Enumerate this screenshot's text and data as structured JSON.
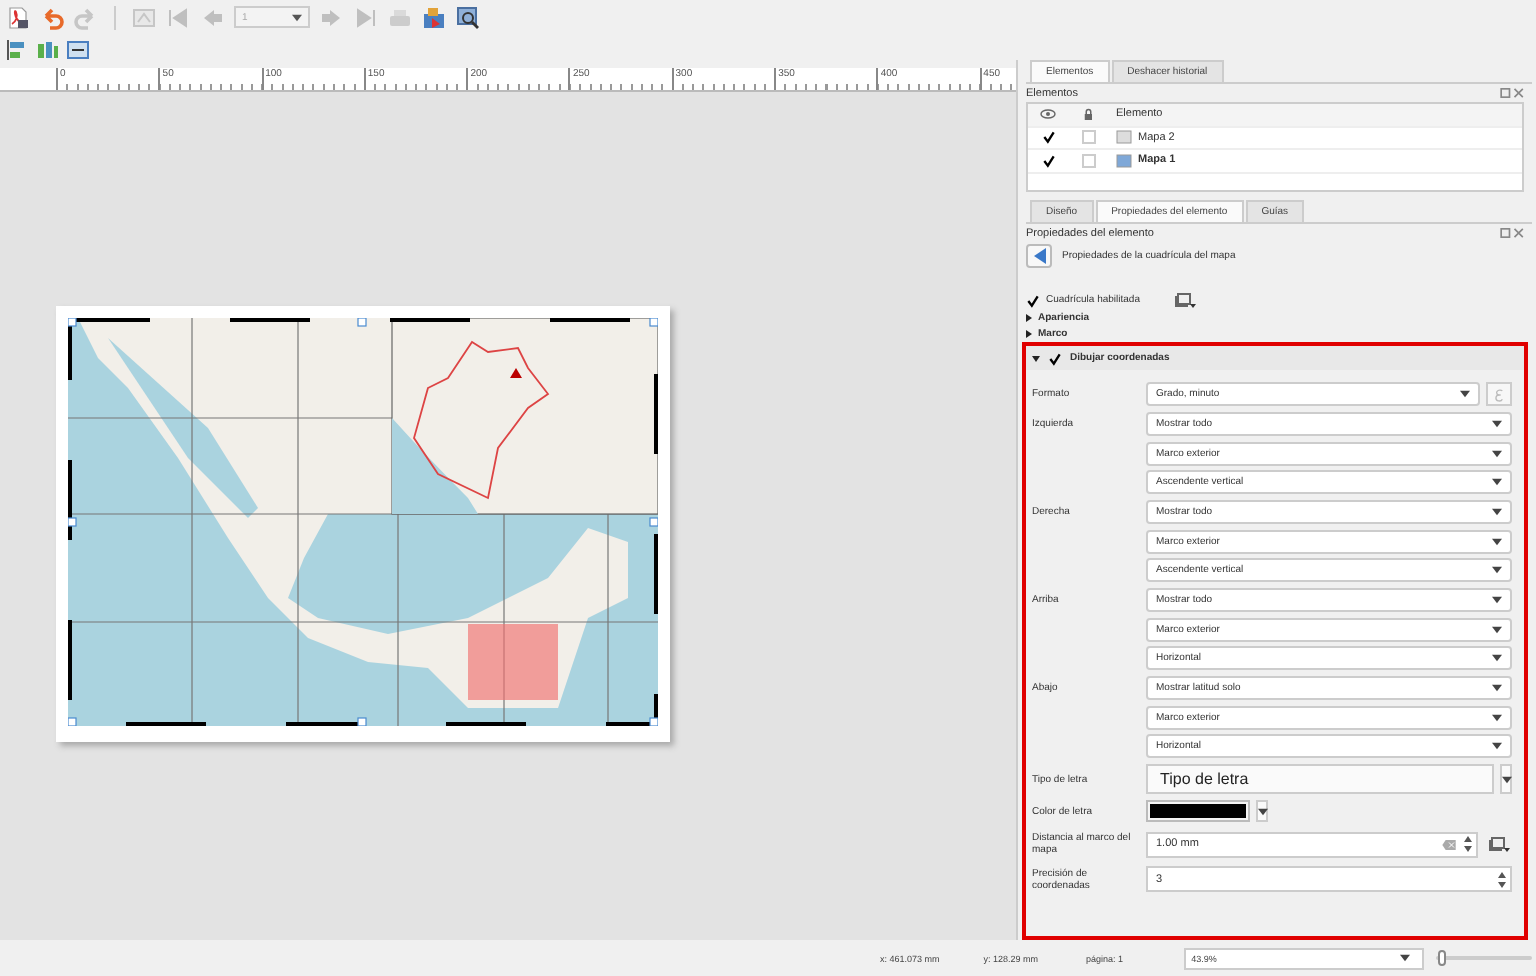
{
  "toolbar_top": [
    {
      "kind": "pdf",
      "disabled": false
    },
    {
      "kind": "undo",
      "disabled": false
    },
    {
      "kind": "redo",
      "disabled": true
    },
    {
      "kind": "separator"
    },
    {
      "kind": "atlas",
      "disabled": true
    },
    {
      "kind": "first",
      "disabled": true
    },
    {
      "kind": "previous",
      "disabled": true
    },
    {
      "kind": "page",
      "disabled": true,
      "value": "1"
    },
    {
      "kind": "next",
      "disabled": true
    },
    {
      "kind": "last",
      "disabled": true
    },
    {
      "kind": "print",
      "disabled": true
    },
    {
      "kind": "export",
      "disabled": false
    },
    {
      "kind": "zoom",
      "disabled": false
    }
  ],
  "toolbar_second": [
    {
      "kind": "align"
    },
    {
      "kind": "distribute"
    },
    {
      "kind": "resize"
    }
  ],
  "ruler": {
    "labels": [
      "0",
      "50",
      "100",
      "150",
      "200",
      "250",
      "300",
      "350",
      "400",
      "450"
    ]
  },
  "tabs_top": [
    {
      "label": "Elementos",
      "selected": true
    },
    {
      "label": "Deshacer historial",
      "selected": false
    }
  ],
  "items_panel": {
    "title": "Elementos",
    "column": "Elemento",
    "rows": [
      {
        "name": "Mapa 2",
        "visible": true,
        "locked": false,
        "selected": false
      },
      {
        "name": "Mapa 1",
        "visible": true,
        "locked": false,
        "selected": true
      }
    ]
  },
  "tabs_bottom": [
    {
      "label": "Diseño",
      "selected": false
    },
    {
      "label": "Propiedades del elemento",
      "selected": true
    },
    {
      "label": "Guías",
      "selected": false
    }
  ],
  "properties": {
    "title": "Propiedades del elemento",
    "subtitle": "Propiedades de la cuadrícula del mapa"
  },
  "grid_enabled": {
    "label": "Cuadrícula habilitada",
    "checked": true
  },
  "sections": [
    {
      "label": "Apariencia",
      "expanded": false
    },
    {
      "label": "Marco",
      "expanded": false
    }
  ],
  "draw_coordinates": {
    "label": "Dibujar coordenadas",
    "checked": true,
    "expanded": true,
    "format": {
      "label": "Formato",
      "value": "Grado, minuto"
    },
    "sides": [
      {
        "label": "Izquierda",
        "values": [
          "Mostrar todo",
          "Marco exterior",
          "Ascendente vertical"
        ]
      },
      {
        "label": "Derecha",
        "values": [
          "Mostrar todo",
          "Marco exterior",
          "Ascendente vertical"
        ]
      },
      {
        "label": "Arriba",
        "values": [
          "Mostrar todo",
          "Marco exterior",
          "Horizontal"
        ]
      },
      {
        "label": "Abajo",
        "values": [
          "Mostrar latitud solo",
          "Marco exterior",
          "Horizontal"
        ]
      }
    ],
    "font": {
      "label": "Tipo de letra",
      "button": "Tipo de letra"
    },
    "font_color": {
      "label": "Color de letra",
      "color": "#000000"
    },
    "distance": {
      "label": "Distancia al marco del mapa",
      "value": "1.00 mm"
    },
    "precision": {
      "label": "Precisión de coordenadas",
      "value": "3"
    }
  },
  "status_bar": {
    "x": "x: 461.073 mm",
    "y": "y: 128.29 mm",
    "page": "página: 1",
    "zoom": "43.9%",
    "zoom_slider": {
      "level": 0.03
    }
  }
}
